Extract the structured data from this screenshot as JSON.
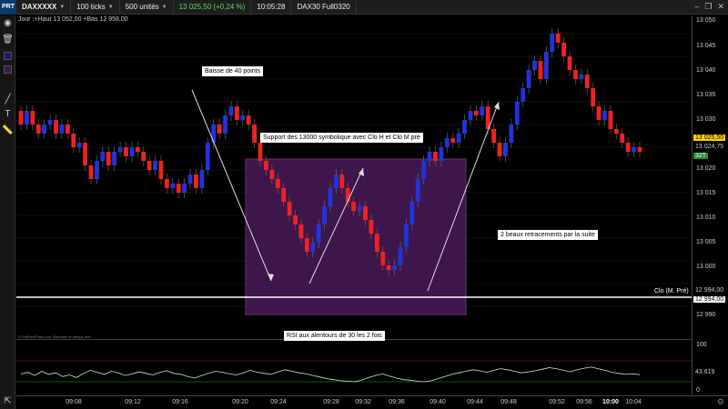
{
  "toolbar": {
    "logo": "PRT",
    "symbol": "DAXXXXX",
    "ticks": "100 ticks",
    "units": "500 unités",
    "quote": "13 025,50 (+0,24 %)",
    "time": "10:05:28",
    "instrument": "DAX30 Full0320"
  },
  "info_line": "Jour :+Haut 13 052,00 +Bas 12 958,00",
  "annotations": {
    "drop": "Baisse de 40 points",
    "support": "Support des 13000 symbolique avec Clo H et Clo M pré",
    "retrace": "2 beaux retracements par la suite",
    "rsi": "RSI aux alentours de 30 les 2 fois"
  },
  "source_note": "© ProRealTime.com. Données en temps réel",
  "price_axis": {
    "ticks": [
      "13 050",
      "13 045",
      "13 040",
      "13 035",
      "13 030",
      "13 020",
      "13 015",
      "13 010",
      "13 005",
      "13 000",
      "12 990"
    ],
    "last_price": "13 025,50",
    "price_2": "13 024,75",
    "counter": "32T",
    "clo_level_1": "12 994,00",
    "clo_level_2": "12 994,00",
    "clo_label": "Clo (M. Pré)"
  },
  "rsi": {
    "upper": "100",
    "value": "43.619",
    "lower": "0"
  },
  "time_axis": {
    "labels": [
      "09:08",
      "09:12",
      "09:16",
      "09:20",
      "09:24",
      "09:28",
      "09:32",
      "09:36",
      "09:40",
      "09:44",
      "09:48",
      "09:52",
      "09:56",
      "10:00",
      "10:04"
    ]
  },
  "colors": {
    "up": "#2233dd",
    "down": "#ee2222",
    "zone": "#4a1a5a",
    "clo_line": "#ffffff",
    "rsi_line": "#dddddd",
    "rsi_upper": "#cc2222",
    "rsi_lower": "#22aa22"
  },
  "icons": [
    "trash-icon",
    "line-tool-icon",
    "text-tool-icon",
    "ruler-icon"
  ],
  "chart_data": {
    "type": "candlestick",
    "ylim": [
      12985,
      13054
    ],
    "candles": [
      {
        "o": 13033,
        "c": 13030
      },
      {
        "o": 13030,
        "c": 13033
      },
      {
        "o": 13033,
        "c": 13030
      },
      {
        "o": 13030,
        "c": 13028
      },
      {
        "o": 13028,
        "c": 13030
      },
      {
        "o": 13030,
        "c": 13031
      },
      {
        "o": 13031,
        "c": 13028
      },
      {
        "o": 13028,
        "c": 13030
      },
      {
        "o": 13030,
        "c": 13028
      },
      {
        "o": 13028,
        "c": 13025
      },
      {
        "o": 13025,
        "c": 13026
      },
      {
        "o": 13026,
        "c": 13021
      },
      {
        "o": 13021,
        "c": 13018
      },
      {
        "o": 13018,
        "c": 13022
      },
      {
        "o": 13022,
        "c": 13024
      },
      {
        "o": 13024,
        "c": 13021
      },
      {
        "o": 13021,
        "c": 13024
      },
      {
        "o": 13024,
        "c": 13025
      },
      {
        "o": 13025,
        "c": 13023
      },
      {
        "o": 13023,
        "c": 13025
      },
      {
        "o": 13025,
        "c": 13024
      },
      {
        "o": 13024,
        "c": 13022
      },
      {
        "o": 13022,
        "c": 13020
      },
      {
        "o": 13020,
        "c": 13022
      },
      {
        "o": 13022,
        "c": 13018
      },
      {
        "o": 13018,
        "c": 13016
      },
      {
        "o": 13016,
        "c": 13017
      },
      {
        "o": 13017,
        "c": 13015
      },
      {
        "o": 13015,
        "c": 13017
      },
      {
        "o": 13017,
        "c": 13019
      },
      {
        "o": 13019,
        "c": 13016
      },
      {
        "o": 13016,
        "c": 13020
      },
      {
        "o": 13020,
        "c": 13026
      },
      {
        "o": 13026,
        "c": 13030
      },
      {
        "o": 13030,
        "c": 13028
      },
      {
        "o": 13028,
        "c": 13032
      },
      {
        "o": 13032,
        "c": 13034
      },
      {
        "o": 13034,
        "c": 13031
      },
      {
        "o": 13031,
        "c": 13032
      },
      {
        "o": 13032,
        "c": 13030
      },
      {
        "o": 13030,
        "c": 13026
      },
      {
        "o": 13026,
        "c": 13022
      },
      {
        "o": 13022,
        "c": 13020
      },
      {
        "o": 13020,
        "c": 13018
      },
      {
        "o": 13018,
        "c": 13016
      },
      {
        "o": 13016,
        "c": 13013
      },
      {
        "o": 13013,
        "c": 13010
      },
      {
        "o": 13010,
        "c": 13008
      },
      {
        "o": 13008,
        "c": 13005
      },
      {
        "o": 13005,
        "c": 13002
      },
      {
        "o": 13002,
        "c": 13004
      },
      {
        "o": 13004,
        "c": 13008
      },
      {
        "o": 13008,
        "c": 13012
      },
      {
        "o": 13012,
        "c": 13016
      },
      {
        "o": 13016,
        "c": 13019
      },
      {
        "o": 13019,
        "c": 13016
      },
      {
        "o": 13016,
        "c": 13013
      },
      {
        "o": 13013,
        "c": 13011
      },
      {
        "o": 13011,
        "c": 13012
      },
      {
        "o": 13012,
        "c": 13009
      },
      {
        "o": 13009,
        "c": 13006
      },
      {
        "o": 13006,
        "c": 13002
      },
      {
        "o": 13002,
        "c": 12999
      },
      {
        "o": 12999,
        "c": 12998
      },
      {
        "o": 12998,
        "c": 12999
      },
      {
        "o": 12999,
        "c": 13003
      },
      {
        "o": 13003,
        "c": 13008
      },
      {
        "o": 13008,
        "c": 13013
      },
      {
        "o": 13013,
        "c": 13018
      },
      {
        "o": 13018,
        "c": 13022
      },
      {
        "o": 13022,
        "c": 13024
      },
      {
        "o": 13024,
        "c": 13022
      },
      {
        "o": 13022,
        "c": 13025
      },
      {
        "o": 13025,
        "c": 13027
      },
      {
        "o": 13027,
        "c": 13026
      },
      {
        "o": 13026,
        "c": 13028
      },
      {
        "o": 13028,
        "c": 13031
      },
      {
        "o": 13031,
        "c": 13033
      },
      {
        "o": 13033,
        "c": 13032
      },
      {
        "o": 13032,
        "c": 13034
      },
      {
        "o": 13034,
        "c": 13029
      },
      {
        "o": 13029,
        "c": 13026
      },
      {
        "o": 13026,
        "c": 13023
      },
      {
        "o": 13023,
        "c": 13026
      },
      {
        "o": 13026,
        "c": 13030
      },
      {
        "o": 13030,
        "c": 13035
      },
      {
        "o": 13035,
        "c": 13038
      },
      {
        "o": 13038,
        "c": 13042
      },
      {
        "o": 13042,
        "c": 13044
      },
      {
        "o": 13044,
        "c": 13040
      },
      {
        "o": 13040,
        "c": 13046
      },
      {
        "o": 13046,
        "c": 13050
      },
      {
        "o": 13050,
        "c": 13048
      },
      {
        "o": 13048,
        "c": 13045
      },
      {
        "o": 13045,
        "c": 13042
      },
      {
        "o": 13042,
        "c": 13040
      },
      {
        "o": 13040,
        "c": 13041
      },
      {
        "o": 13041,
        "c": 13038
      },
      {
        "o": 13038,
        "c": 13034
      },
      {
        "o": 13034,
        "c": 13031
      },
      {
        "o": 13031,
        "c": 13033
      },
      {
        "o": 13033,
        "c": 13029
      },
      {
        "o": 13029,
        "c": 13028
      },
      {
        "o": 13028,
        "c": 13026
      },
      {
        "o": 13026,
        "c": 13024
      },
      {
        "o": 13024,
        "c": 13025
      },
      {
        "o": 13025,
        "c": 13024
      }
    ],
    "rsi_values": [
      45,
      48,
      42,
      50,
      44,
      47,
      40,
      43,
      38,
      46,
      52,
      48,
      44,
      50,
      47,
      42,
      45,
      49,
      46,
      43,
      48,
      51,
      46,
      44,
      40,
      37,
      42,
      46,
      50,
      48,
      45,
      43,
      47,
      52,
      48,
      46,
      44,
      49,
      53,
      50,
      47,
      45,
      42,
      39,
      36,
      34,
      32,
      31,
      30,
      33,
      38,
      42,
      45,
      41,
      37,
      34,
      33,
      31,
      30,
      32,
      36,
      40,
      44,
      47,
      50,
      53,
      51,
      48,
      52,
      55,
      53,
      50,
      47,
      49,
      51,
      54,
      57,
      55,
      52,
      49,
      53,
      56,
      58,
      55,
      52,
      48,
      46,
      44,
      45,
      43.6
    ]
  }
}
